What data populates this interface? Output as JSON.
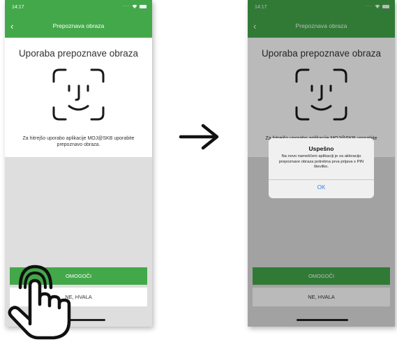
{
  "status_bar": {
    "time": "14:17"
  },
  "nav": {
    "title": "Prepoznava obraza"
  },
  "screen": {
    "heading": "Uporaba prepoznave obraza",
    "description": "Za hitrejšo uporabo aplikacije MOJ@SKB uporabite prepoznavo obraza.",
    "primary_button": "OMOGOČI",
    "secondary_button": "NE, HVALA"
  },
  "alert": {
    "title": "Uspešno",
    "message": "Na novo nameščeni aplikaciji je za aktivacijo prepoznave obraza potrebna prva prijava s PIN številko.",
    "ok_label": "OK"
  },
  "icons": {
    "back": "chevron-left-icon",
    "face_id": "face-id-icon",
    "arrow": "arrow-right-icon",
    "hand": "pointing-hand-icon",
    "battery": "battery-icon",
    "signal": "signal-icon"
  },
  "colors": {
    "brand_green": "#43a84a",
    "gray_area": "#dedede",
    "alert_ok": "#3a7bd5",
    "alert_bg": "#f0f0f0"
  }
}
